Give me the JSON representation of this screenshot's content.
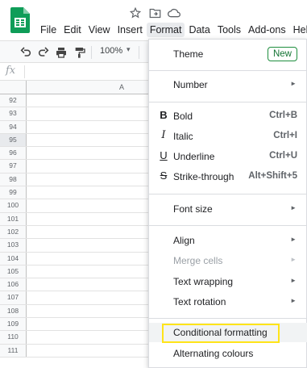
{
  "colors": {
    "sheets_green": "#0f9d58",
    "highlight": "#ffe419",
    "new_badge": "#137333"
  },
  "icons": {
    "star": "☆",
    "move": "⬒",
    "cloud": "☁",
    "undo": "↶",
    "redo": "↷",
    "print": "🖶",
    "paint_format": "🖌"
  },
  "menubar": {
    "items": [
      "File",
      "Edit",
      "View",
      "Insert",
      "Format",
      "Data",
      "Tools",
      "Add-ons",
      "Hel"
    ]
  },
  "toolbar": {
    "zoom": "100%",
    "zoom_caret": "▾"
  },
  "formula": {
    "fx": "fx"
  },
  "grid": {
    "column": "A",
    "rows": [
      "92",
      "93",
      "94",
      "95",
      "96",
      "97",
      "98",
      "99",
      "100",
      "101",
      "102",
      "103",
      "104",
      "105",
      "106",
      "107",
      "108",
      "109",
      "110",
      "111"
    ]
  },
  "format_menu": {
    "theme": {
      "label": "Theme",
      "badge": "New"
    },
    "number": {
      "label": "Number",
      "arrow": "►"
    },
    "bold": {
      "icon": "B",
      "label": "Bold",
      "shortcut": "Ctrl+B"
    },
    "italic": {
      "icon": "I",
      "label": "Italic",
      "shortcut": "Ctrl+I"
    },
    "underline": {
      "icon": "U",
      "label": "Underline",
      "shortcut": "Ctrl+U"
    },
    "strike": {
      "icon": "S",
      "label": "Strike-through",
      "shortcut": "Alt+Shift+5"
    },
    "font_size": {
      "label": "Font size",
      "arrow": "►"
    },
    "align": {
      "label": "Align",
      "arrow": "►"
    },
    "merge": {
      "label": "Merge cells",
      "arrow": "►"
    },
    "wrapping": {
      "label": "Text wrapping",
      "arrow": "►"
    },
    "rotation": {
      "label": "Text rotation",
      "arrow": "►"
    },
    "conditional": {
      "label": "Conditional formatting"
    },
    "alternating": {
      "label": "Alternating colours"
    }
  }
}
